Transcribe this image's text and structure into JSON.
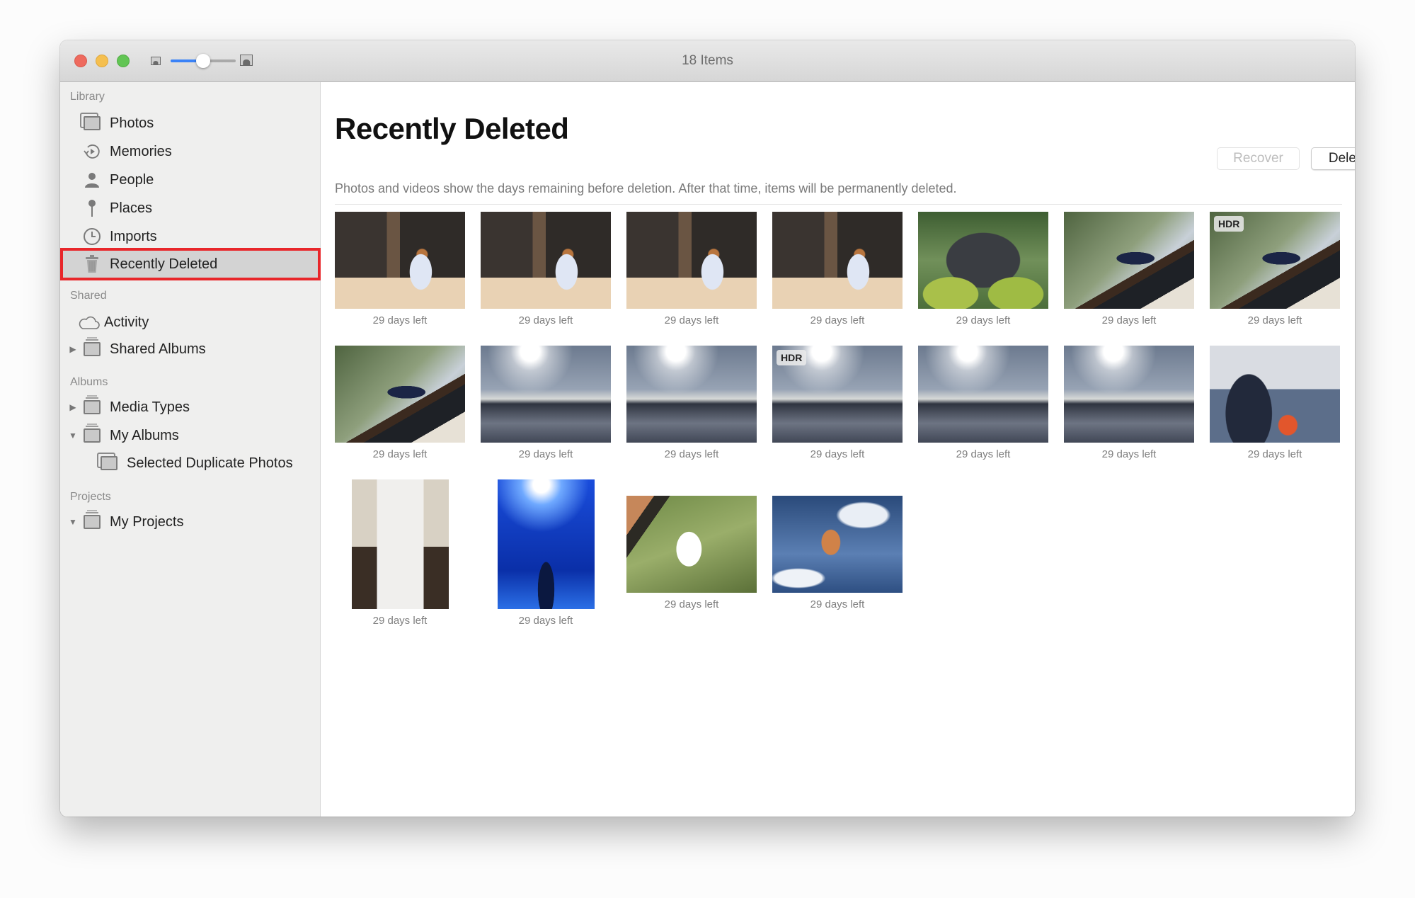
{
  "window": {
    "title": "18 Items",
    "zoom_slider": {
      "value": 0.5
    }
  },
  "sidebar": {
    "sections": [
      {
        "label": "Library",
        "items": [
          {
            "label": "Photos",
            "icon": "photos-icon"
          },
          {
            "label": "Memories",
            "icon": "memories-icon"
          },
          {
            "label": "People",
            "icon": "person-icon"
          },
          {
            "label": "Places",
            "icon": "pin-icon"
          },
          {
            "label": "Imports",
            "icon": "clock-icon"
          },
          {
            "label": "Recently Deleted",
            "icon": "trash-icon",
            "selected": true
          }
        ]
      },
      {
        "label": "Shared",
        "items": [
          {
            "label": "Activity",
            "icon": "cloud-icon"
          },
          {
            "label": "Shared Albums",
            "icon": "album-icon",
            "disclosure": "collapsed"
          }
        ]
      },
      {
        "label": "Albums",
        "items": [
          {
            "label": "Media Types",
            "icon": "album-icon",
            "disclosure": "collapsed"
          },
          {
            "label": "My Albums",
            "icon": "album-icon",
            "disclosure": "expanded"
          },
          {
            "label": "Selected Duplicate Photos",
            "icon": "photos-icon",
            "indent": true
          }
        ]
      },
      {
        "label": "Projects",
        "items": [
          {
            "label": "My Projects",
            "icon": "album-icon",
            "disclosure": "expanded"
          }
        ]
      }
    ]
  },
  "main": {
    "title": "Recently Deleted",
    "subtitle": "Photos and videos show the days remaining before deletion. After that time, items will be permanently deleted.",
    "buttons": {
      "recover": {
        "label": "Recover",
        "enabled": false
      },
      "delete_all": {
        "label": "Delete All",
        "enabled": true
      }
    },
    "items": [
      {
        "subject": "woman on beach",
        "days_left": "29 days left",
        "hdr": false
      },
      {
        "subject": "woman on beach",
        "days_left": "29 days left",
        "hdr": false
      },
      {
        "subject": "woman on beach",
        "days_left": "29 days left",
        "hdr": false
      },
      {
        "subject": "woman on beach",
        "days_left": "29 days left",
        "hdr": false
      },
      {
        "subject": "rock with plaque",
        "days_left": "29 days left",
        "hdr": false
      },
      {
        "subject": "peacock on roof",
        "days_left": "29 days left",
        "hdr": false
      },
      {
        "subject": "peacock on roof",
        "days_left": "29 days left",
        "hdr": true,
        "badge": "HDR"
      },
      {
        "subject": "peacock on roof",
        "days_left": "29 days left",
        "hdr": false
      },
      {
        "subject": "sunlit sea",
        "days_left": "29 days left",
        "hdr": false
      },
      {
        "subject": "sunlit sea",
        "days_left": "29 days left",
        "hdr": false
      },
      {
        "subject": "sunlit sea",
        "days_left": "29 days left",
        "hdr": true,
        "badge": "HDR"
      },
      {
        "subject": "sunlit sea",
        "days_left": "29 days left",
        "hdr": false
      },
      {
        "subject": "sunlit sea",
        "days_left": "29 days left",
        "hdr": false
      },
      {
        "subject": "man sailing",
        "days_left": "29 days left",
        "hdr": false
      },
      {
        "subject": "girl on stairs",
        "days_left": "29 days left",
        "hdr": false,
        "orientation": "portrait"
      },
      {
        "subject": "aquarium shark",
        "days_left": "29 days left",
        "hdr": false,
        "orientation": "portrait"
      },
      {
        "subject": "swan on grass",
        "days_left": "29 days left",
        "hdr": false
      },
      {
        "subject": "flag in sky",
        "days_left": "29 days left",
        "hdr": false
      }
    ]
  },
  "colors": {
    "selection_outline": "#e8262a",
    "slider_accent": "#3a82f7"
  }
}
